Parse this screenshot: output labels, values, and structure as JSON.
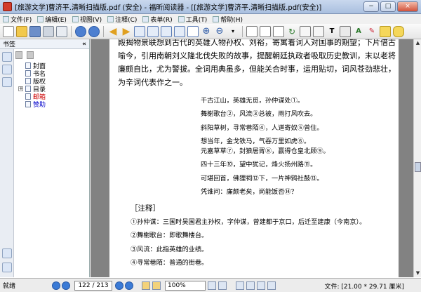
{
  "window": {
    "title": "[旅游文学]曹济平.清晰扫描版.pdf (安全) - 福昕阅读器 - [[旅游文学]曹济平.清晰扫描版.pdf(安全)]",
    "minimize": "−",
    "maximize": "□",
    "close": "×"
  },
  "menu": [
    "文件(F)",
    "编辑(E)",
    "视图(V)",
    "注释(C)",
    "表单(R)",
    "工具(T)",
    "帮助(H)"
  ],
  "sidebar": {
    "title": "书签",
    "collapse": "«",
    "bookmarks": [
      {
        "label": "封面",
        "color": "#000000"
      },
      {
        "label": "书名",
        "color": "#000000"
      },
      {
        "label": "版权",
        "color": "#000000"
      },
      {
        "label": "目录",
        "color": "#000000",
        "expandable": true
      },
      {
        "label": "邮箱",
        "color": "#cc0000"
      },
      {
        "label": "赞助",
        "color": "#0000cc"
      }
    ]
  },
  "document": {
    "intro": "殿揭物景联想到古代的英雄人物孙权、刘裕，寄寓着词人对国事的期望；下片借古喻今，引用南朝刘义隆北伐失败的故事，提醒朝廷执政者吸取历史教训，末以老将廉颇自比，尤为警拔。全词用典虽多，但能关合时事，运用贴切，词风苍劲悲壮，为辛词代表作之一。",
    "poem_stanza1": [
      "千古江山，英雄无觅，孙仲谋处①。",
      "舞榭歌台②，风流③总被，雨打风吹去。",
      "斜阳草树，寻常巷陌④，人道寄奴⑤曾住。",
      "想当年，金戈铁马，气吞万里如虎⑥。"
    ],
    "poem_stanza2": [
      "元嘉草草⑦，封狼居胥⑧，赢得仓皇北顾⑨。",
      "四十三年⑩，望中犹记，烽火扬州路⑪。",
      "可堪回首，佛狸祠⑫下，一片神鸦社鼓⑬。",
      "凭谁问：廉颇老矣，尚能饭否⑭？"
    ],
    "notes_title": "［注释］",
    "notes": [
      "①孙仲谋：三国时吴国君主孙权，字仲谋，曾建都于京口，后迁至建康（今南京）。",
      "②舞榭歌台：即歌舞楼台。",
      "③风流：此指英雄的业绩。",
      "④寻常巷陌：普通的街巷。"
    ]
  },
  "status": {
    "ready": "就绪",
    "page": "122 / 213",
    "zoom": "100%",
    "doc_size": "文件: [21.00 * 29.71 厘米]"
  }
}
